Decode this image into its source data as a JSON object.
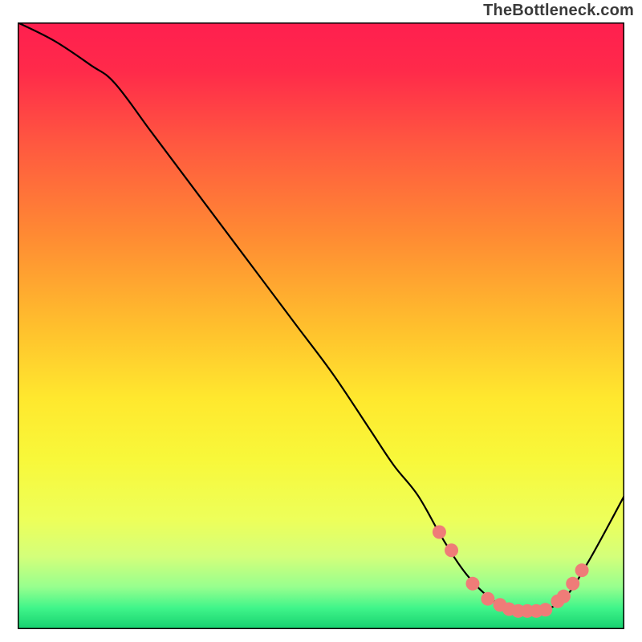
{
  "attribution": "TheBottleneck.com",
  "chart_data": {
    "type": "line",
    "title": "",
    "xlabel": "",
    "ylabel": "",
    "xlim": [
      0,
      100
    ],
    "ylim": [
      0,
      100
    ],
    "grid": false,
    "legend": false,
    "series": [
      {
        "name": "bottleneck-curve",
        "color": "#000000",
        "x": [
          0,
          6,
          12,
          16,
          22,
          28,
          34,
          40,
          46,
          52,
          58,
          62,
          66,
          70,
          74,
          78,
          82,
          86,
          90,
          94,
          100
        ],
        "y": [
          100,
          97,
          93,
          90,
          82,
          74,
          66,
          58,
          50,
          42,
          33,
          27,
          22,
          15,
          9,
          5,
          3,
          3,
          5,
          11,
          22
        ]
      }
    ],
    "marker_points": {
      "name": "highlighted-points",
      "color": "#ef7c78",
      "x": [
        69.5,
        71.5,
        75.0,
        77.5,
        79.5,
        81.0,
        82.5,
        84.0,
        85.5,
        87.0,
        89.0,
        90.0,
        91.5,
        93.0
      ],
      "y": [
        16.0,
        13.0,
        7.5,
        5.0,
        4.0,
        3.3,
        3.0,
        3.0,
        3.0,
        3.2,
        4.6,
        5.4,
        7.5,
        9.7
      ]
    },
    "gradient_stops": [
      {
        "offset": 0.0,
        "color": "#ff1f4f"
      },
      {
        "offset": 0.08,
        "color": "#ff2a4a"
      },
      {
        "offset": 0.2,
        "color": "#ff5840"
      },
      {
        "offset": 0.35,
        "color": "#ff8a33"
      },
      {
        "offset": 0.5,
        "color": "#ffbf2d"
      },
      {
        "offset": 0.62,
        "color": "#ffe82e"
      },
      {
        "offset": 0.72,
        "color": "#f8f83a"
      },
      {
        "offset": 0.82,
        "color": "#edff5a"
      },
      {
        "offset": 0.88,
        "color": "#d4ff7a"
      },
      {
        "offset": 0.93,
        "color": "#98ff8e"
      },
      {
        "offset": 0.965,
        "color": "#40f58a"
      },
      {
        "offset": 1.0,
        "color": "#15d06e"
      }
    ]
  }
}
